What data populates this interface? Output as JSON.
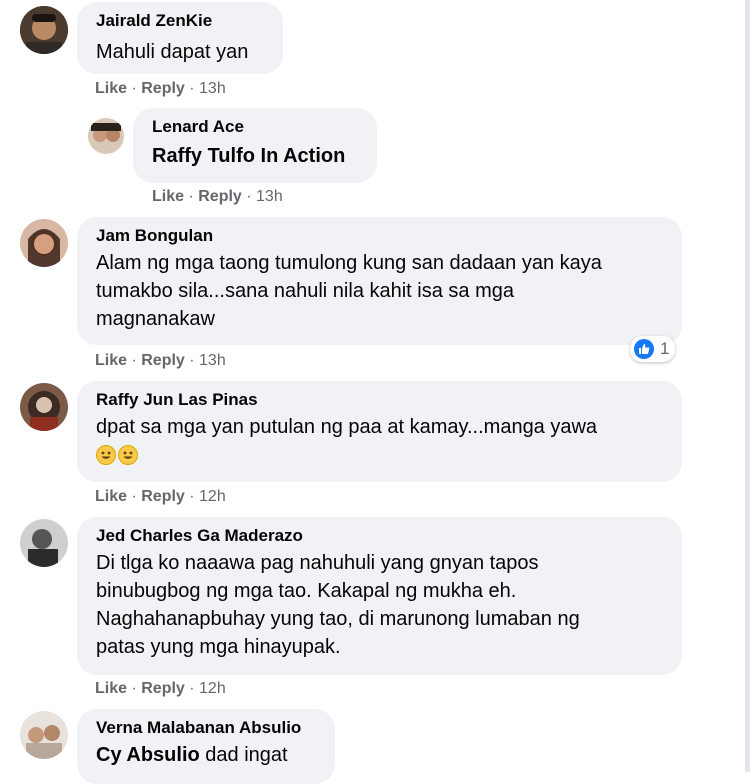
{
  "comments": [
    {
      "author": "Jairald ZenKie",
      "text": "Mahuli dapat yan",
      "like": "Like",
      "reply": "Reply",
      "time": "13h"
    },
    {
      "author": "Lenard Ace",
      "mention": "Raffy Tulfo In Action",
      "like": "Like",
      "reply": "Reply",
      "time": "13h"
    },
    {
      "author": "Jam Bongulan",
      "lines": [
        "Alam ng mga taong tumulong kung san dadaan yan kaya",
        "tumakbo sila...sana nahuli nila kahit isa sa mga",
        "magnanakaw"
      ],
      "like": "Like",
      "reply": "Reply",
      "time": "13h",
      "reaction_count": "1"
    },
    {
      "author": "Raffy Jun Las Pinas",
      "text": "dpat sa mga yan putulan ng paa at kamay...manga yawa",
      "emojis": [
        "grin-emoji",
        "grin-emoji"
      ],
      "like": "Like",
      "reply": "Reply",
      "time": "12h"
    },
    {
      "author": "Jed Charles Ga Maderazo",
      "lines": [
        "Di tlga ko naaawa pag nahuhuli yang gnyan tapos",
        "binubugbog ng mga tao. Kakapal ng mukha eh.",
        "Naghahanapbuhay yung tao, di marunong lumaban ng",
        "patas yung mga hinayupak."
      ],
      "like": "Like",
      "reply": "Reply",
      "time": "12h"
    },
    {
      "author": "Verna Malabanan Absulio",
      "mention": "Cy Absulio",
      "text": " dad ingat"
    }
  ],
  "separator": " · ",
  "colors": {
    "bubble": "#f0f2f5",
    "meta": "#65676b",
    "like_blue": "#1877f2"
  }
}
